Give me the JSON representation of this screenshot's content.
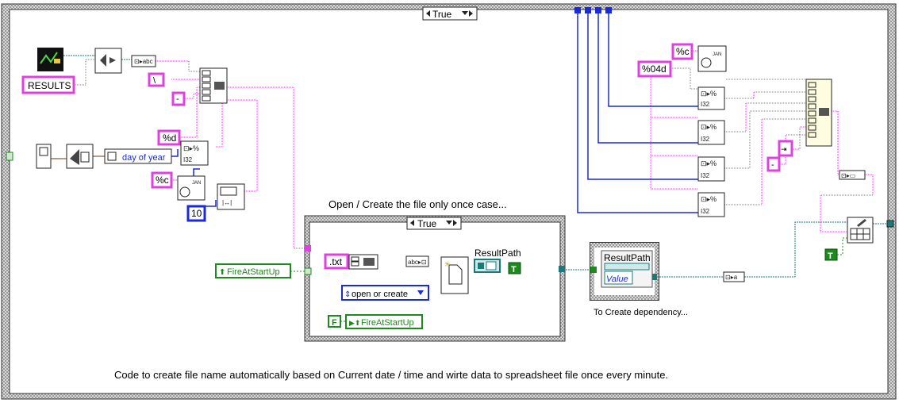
{
  "outer_case": {
    "selector": "True"
  },
  "inner_case": {
    "selector": "True",
    "caption": "Open / Create the file only once case..."
  },
  "constants": {
    "results": "RESULTS",
    "backslash": "\\",
    "dash": "-",
    "fmt_d": "%d",
    "fmt_c1": "%c",
    "ten": "10",
    "fmt_04d": "%04d",
    "fmt_c2": "%c",
    "txt": ".txt",
    "open_or_create": "open or create",
    "true_const": "T",
    "false_const": "F",
    "true_const2": "T",
    "dash2": "-"
  },
  "labels": {
    "day_of_year": "day of year",
    "fire_at_startup_outer": "FireAtStartUp",
    "fire_at_startup_inner": "FireAtStartUp",
    "result_path": "ResultPath",
    "property_node_title": "ResultPath",
    "property_node_value": "Value",
    "dependency_caption": "To Create dependency...",
    "footer": "Code to create file name automatically based on Current date / time and wirte data to spreadsheet file once every minute."
  },
  "colors": {
    "string_wire": "#e040e0",
    "path_wire": "#1a7a7a",
    "number_wire": "#1a2ad8",
    "boolean_wire": "#1c8a1c",
    "structure_border": "#444444"
  }
}
